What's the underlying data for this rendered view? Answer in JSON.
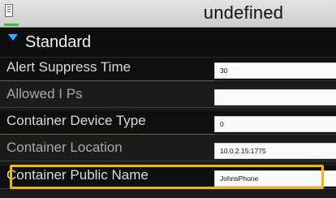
{
  "app": {
    "title": "undefined"
  },
  "section": {
    "title": "Standard"
  },
  "rows": [
    {
      "label": "Alert Suppress Time",
      "value": "30"
    },
    {
      "label": "Allowed I Ps",
      "value": ""
    },
    {
      "label": "Container Device Type",
      "value": "0"
    },
    {
      "label": "Container Location",
      "value": "10.0.2.15:1775"
    },
    {
      "label": "Container Public Name",
      "value": "JohnsPhone"
    }
  ],
  "colors": {
    "accent_green": "#39c12a",
    "chevron_blue": "#3aa7ff",
    "highlight_yellow": "#f5b800"
  },
  "icons": {
    "title_icon": "device-icon",
    "section_icon": "chevron-down-icon"
  }
}
